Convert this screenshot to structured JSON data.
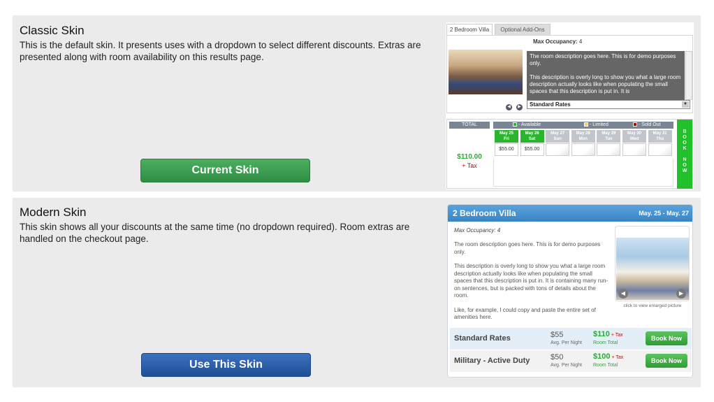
{
  "classic": {
    "title": "Classic Skin",
    "description": "This is the default skin. It presents uses with a dropdown to select different discounts. Extras are presented along with room availability on this results page.",
    "button_label": "Current Skin",
    "preview": {
      "tabs": [
        "2 Bedroom Villa",
        "Optional Add-Ons"
      ],
      "max_occupancy_label": "Max Occupancy:",
      "max_occupancy_value": "4",
      "description_p1": "The room description goes here. This is for demo purposes only.",
      "description_p2": "This description is overly long to show you what a large room description actually looks like when populating the small spaces that this description is put in. It is",
      "rate_select": "Standard Rates",
      "total_label": "TOTAL",
      "total_price": "$110.00",
      "tax_label": "+ Tax",
      "legend": [
        {
          "label": "- Available",
          "color": "#2bb52e"
        },
        {
          "label": "- Limited",
          "color": "#f0d060"
        },
        {
          "label": "- Sold Out",
          "color": "#c00000"
        }
      ],
      "days": [
        {
          "date": "May 25",
          "dow": "Fri",
          "price": "$55.00",
          "status": "available"
        },
        {
          "date": "May 26",
          "dow": "Sat",
          "price": "$55.00",
          "status": "available"
        },
        {
          "date": "May 27",
          "dow": "Sun",
          "price": "",
          "status": "none"
        },
        {
          "date": "May 28",
          "dow": "Mon",
          "price": "",
          "status": "none"
        },
        {
          "date": "May 29",
          "dow": "Tue",
          "price": "",
          "status": "none"
        },
        {
          "date": "May 30",
          "dow": "Wed",
          "price": "",
          "status": "none"
        },
        {
          "date": "May 31",
          "dow": "Thu",
          "price": "",
          "status": "none"
        }
      ],
      "book_now": "BOOK NOW"
    }
  },
  "modern": {
    "title": "Modern Skin",
    "description": "This skin shows all your discounts at the same time (no dropdown required). Room extras are handled on the checkout page.",
    "button_label": "Use This Skin",
    "preview": {
      "room_name": "2 Bedroom Villa",
      "dates": "May. 25 - May. 27",
      "max_occupancy": "Max Occupancy: 4",
      "description_p1": "The room description goes here. This is for demo purposes only.",
      "description_p2": "This description is overly long to show you what a large room description actually looks like when populating the small spaces that this description is put in. It is containing many run-on sentences, but is packed with tons of details about the room.",
      "description_p3": "Like, for example, I could copy and paste the entire set of amenities here.",
      "photo_caption": "click to view enlarged picture",
      "rates": [
        {
          "name": "Standard Rates",
          "nightly": "$55",
          "nightly_label": "Avg. Per Night",
          "total": "$110",
          "tax": "+ Tax",
          "total_label": "Room Total",
          "button": "Book Now"
        },
        {
          "name": "Military - Active Duty",
          "nightly": "$50",
          "nightly_label": "Avg. Per Night",
          "total": "$100",
          "tax": "+ Tax",
          "total_label": "Room Total",
          "button": "Book Now"
        }
      ]
    }
  }
}
